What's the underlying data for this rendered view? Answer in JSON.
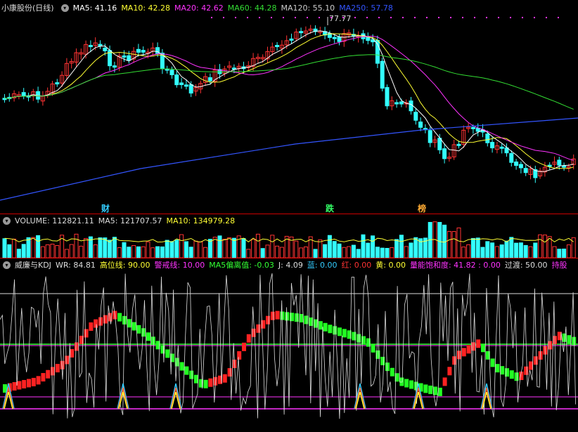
{
  "main": {
    "title": "小康股份(日线)",
    "ma": [
      {
        "label": "MA5: 41.16",
        "color": "#ffffff"
      },
      {
        "label": "MA10: 42.28",
        "color": "#ffff33"
      },
      {
        "label": "MA20: 42.62",
        "color": "#ff33ff"
      },
      {
        "label": "MA60: 44.28",
        "color": "#33dd33"
      },
      {
        "label": "MA120: 55.10",
        "color": "#cccccc"
      },
      {
        "label": "MA250: 57.78",
        "color": "#3355ff"
      }
    ],
    "peak_label": "77.77",
    "markers": [
      {
        "text": "财",
        "color": "#33ccff"
      },
      {
        "text": "跌",
        "color": "#33ff66"
      },
      {
        "text": "榜",
        "color": "#ffaa33"
      }
    ]
  },
  "volume": {
    "labels": [
      {
        "label": "VOLUME: 112821.11",
        "color": "#dddddd"
      },
      {
        "label": "MA5: 121707.57",
        "color": "#dddddd"
      },
      {
        "label": "MA10: 134979.28",
        "color": "#ffff33"
      }
    ]
  },
  "indicator": {
    "labels": [
      {
        "label": "威廉与KDJ",
        "color": "#dddddd"
      },
      {
        "label": "WR: 84.81",
        "color": "#dddddd"
      },
      {
        "label": "高位线: 90.00",
        "color": "#ffff33"
      },
      {
        "label": "警戒线: 10.00",
        "color": "#ff33ff"
      },
      {
        "label": "MA5偏离值: -0.03",
        "color": "#33ff33"
      },
      {
        "label": "J: 4.09",
        "color": "#dddddd"
      },
      {
        "label": "蓝: 0.00",
        "color": "#33ccff"
      },
      {
        "label": "红: 0.00",
        "color": "#ff3333"
      },
      {
        "label": "黄: 0.00",
        "color": "#ffff33"
      },
      {
        "label": "量能饱和度: 41.82 : 0.00",
        "color": "#ff33ff"
      },
      {
        "label": "过渡: 50.00",
        "color": "#dddddd"
      },
      {
        "label": "持股",
        "color": "#ff33ff"
      }
    ]
  },
  "colors": {
    "up": "#ff3333",
    "down": "#33ffff",
    "separator": "#cc0000"
  }
}
